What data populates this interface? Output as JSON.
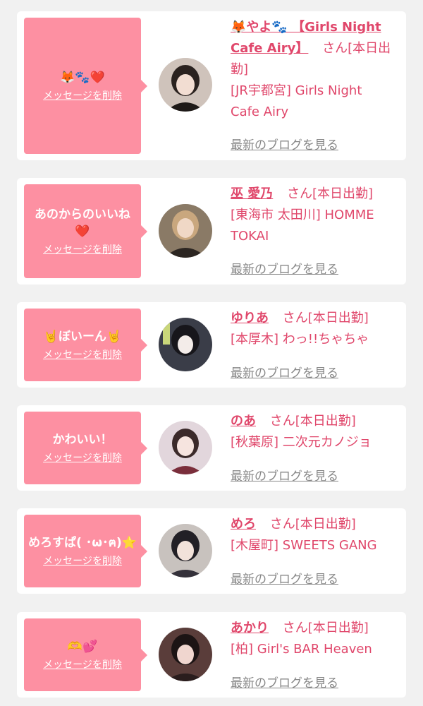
{
  "accent_color": "#e0476b",
  "bubble_color": "#fd90a2",
  "delete_label": "メッセージを削除",
  "san_label": "さん",
  "blog_label": "最新のブログを見る",
  "cards": [
    {
      "message": "🦊🐾❤️",
      "name": "🦊やよ🐾 【Girls Night Cafe Airy】",
      "status": "[本日出勤]",
      "shop": "[JR宇都宮] Girls Night Cafe Airy"
    },
    {
      "message": "あのからのいいね❤️",
      "name": "巫 愛乃",
      "status": "[本日出勤]",
      "shop": "[東海市 太田川] HOMME TOKAI"
    },
    {
      "message": "🤘ぼいーん🤘",
      "name": "ゆりあ",
      "status": "[本日出勤]",
      "shop": "[本厚木] わっ!!ちゃちゃ"
    },
    {
      "message": "かわいい！",
      "name": "のあ",
      "status": "[本日出勤]",
      "shop": "[秋葉原] 二次元カノジョ"
    },
    {
      "message": "めろすぱ( ･ω･ฅ)⭐",
      "name": "めろ",
      "status": "[本日出勤]",
      "shop": "[木屋町] SWEETS GANG"
    },
    {
      "message": "🫶💕",
      "name": "あかり",
      "status": "[本日出勤]",
      "shop": "[柏] Girl's BAR Heaven"
    }
  ]
}
